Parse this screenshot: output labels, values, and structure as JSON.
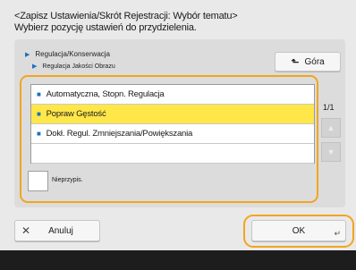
{
  "header": {
    "title": "<Zapisz Ustawienia/Skrót Rejestracji: Wybór tematu>",
    "instruction": "Wybierz pozycję ustawień do przydzielenia."
  },
  "breadcrumb": {
    "level1": "Regulacja/Konserwacja",
    "level2": "Regulacja Jakości Obrazu"
  },
  "top_button": {
    "label": "Góra",
    "icon": "return-up-arrow-icon"
  },
  "list": {
    "items": [
      {
        "label": "Automatyczna, Stopn. Regulacja",
        "selected": false
      },
      {
        "label": "Popraw Gęstość",
        "selected": true
      },
      {
        "label": "Dokł. Regul. Zmniejszania/Powiększania",
        "selected": false
      }
    ],
    "page_indicator": "1/1"
  },
  "checkbox": {
    "label": "Nieprzypis."
  },
  "footer": {
    "cancel_label": "Anuluj",
    "cancel_icon": "x-icon",
    "ok_label": "OK"
  },
  "colors": {
    "highlight": "#f2a51f",
    "selected_row": "#ffe74a",
    "bullet": "#1f6fbf"
  }
}
